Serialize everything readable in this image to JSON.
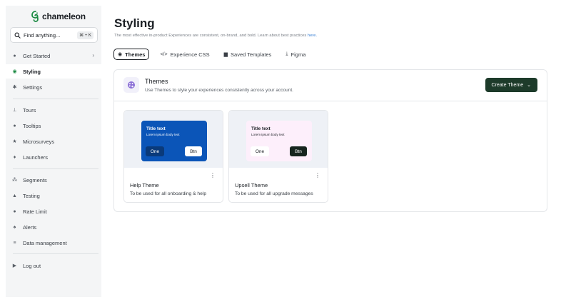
{
  "brand": {
    "name": "chameleon",
    "accent": "#1c8a43"
  },
  "search": {
    "label": "Find anything...",
    "shortcut": "⌘ + K"
  },
  "sidebar": {
    "items": [
      {
        "label": "Get Started",
        "icon": "rocket-icon",
        "chevron": "›"
      },
      {
        "label": "Styling",
        "icon": "palette-icon"
      },
      {
        "label": "Settings",
        "icon": "gear-icon"
      },
      {
        "label": "Tours",
        "icon": "pin-icon"
      },
      {
        "label": "Tooltips",
        "icon": "info-icon"
      },
      {
        "label": "Microsurveys",
        "icon": "star-icon"
      },
      {
        "label": "Launchers",
        "icon": "bulb-icon"
      },
      {
        "label": "Segments",
        "icon": "people-icon"
      },
      {
        "label": "Testing",
        "icon": "flask-icon"
      },
      {
        "label": "Rate Limit",
        "icon": "gauge-icon"
      },
      {
        "label": "Alerts",
        "icon": "bell-icon"
      },
      {
        "label": "Data management",
        "icon": "database-icon"
      },
      {
        "label": "Log out",
        "icon": "logout-icon"
      }
    ],
    "active": "Styling"
  },
  "page": {
    "title": "Styling",
    "description": "The most effective in-product Experiences are consistent, on-brand, and bold. Learn about best practices",
    "description_link": "here."
  },
  "tabs": [
    {
      "label": "Themes",
      "icon": "palette-icon",
      "active": true
    },
    {
      "label": "Experience CSS",
      "icon": "code-icon"
    },
    {
      "label": "Saved Templates",
      "icon": "template-icon"
    },
    {
      "label": "Figma",
      "icon": "download-icon"
    }
  ],
  "themes_panel": {
    "title": "Themes",
    "subtitle": "Use Themes to style your experiences consistently across your account.",
    "create_button": "Create Theme",
    "create_chevron": "⌄"
  },
  "cards": [
    {
      "name": "Help Theme",
      "description": "To be used for all onboarding & help",
      "preview": {
        "title": "Title text",
        "body": "Lorem ipsum body text",
        "button_left": "One",
        "button_right": "Btn",
        "bg": "#0b55b8"
      }
    },
    {
      "name": "Upsell Theme",
      "description": "To be used for all upgrade messages",
      "preview": {
        "title": "Title text",
        "body": "Lorem ipsum body text",
        "button_left": "One",
        "button_right": "Btn",
        "bg": "#fdeffb"
      }
    }
  ],
  "more_glyph": "⋮"
}
